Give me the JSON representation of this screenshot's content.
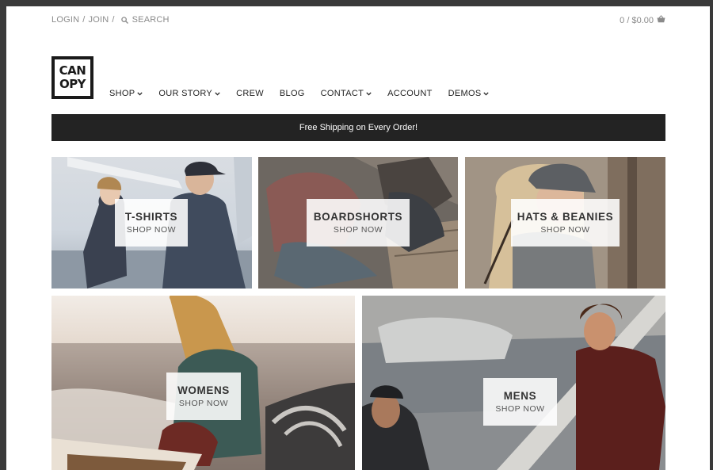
{
  "topbar": {
    "login": "LOGIN",
    "join": "JOIN",
    "search": "SEARCH",
    "cart": "0 / $0.00"
  },
  "logo": {
    "line1": "CAN",
    "line2": "OPY"
  },
  "nav": {
    "items": [
      {
        "label": "SHOP",
        "dropdown": true
      },
      {
        "label": "OUR STORY",
        "dropdown": true
      },
      {
        "label": "CREW",
        "dropdown": false
      },
      {
        "label": "BLOG",
        "dropdown": false
      },
      {
        "label": "CONTACT",
        "dropdown": true
      },
      {
        "label": "ACCOUNT",
        "dropdown": false
      },
      {
        "label": "DEMOS",
        "dropdown": true
      }
    ]
  },
  "banner": {
    "text": "Free Shipping on Every Order!"
  },
  "tiles": [
    {
      "title": "T-SHIRTS",
      "cta": "SHOP NOW"
    },
    {
      "title": "BOARDSHORTS",
      "cta": "SHOP NOW"
    },
    {
      "title": "HATS & BEANIES",
      "cta": "SHOP NOW"
    },
    {
      "title": "WOMENS",
      "cta": "SHOP NOW"
    },
    {
      "title": "MENS",
      "cta": "SHOP NOW"
    }
  ],
  "colors": {
    "background": "#ffffff",
    "frame": "#3a3a3a",
    "banner": "#232323",
    "nav_text": "#222222",
    "topbar_text": "#8a8a8a"
  }
}
